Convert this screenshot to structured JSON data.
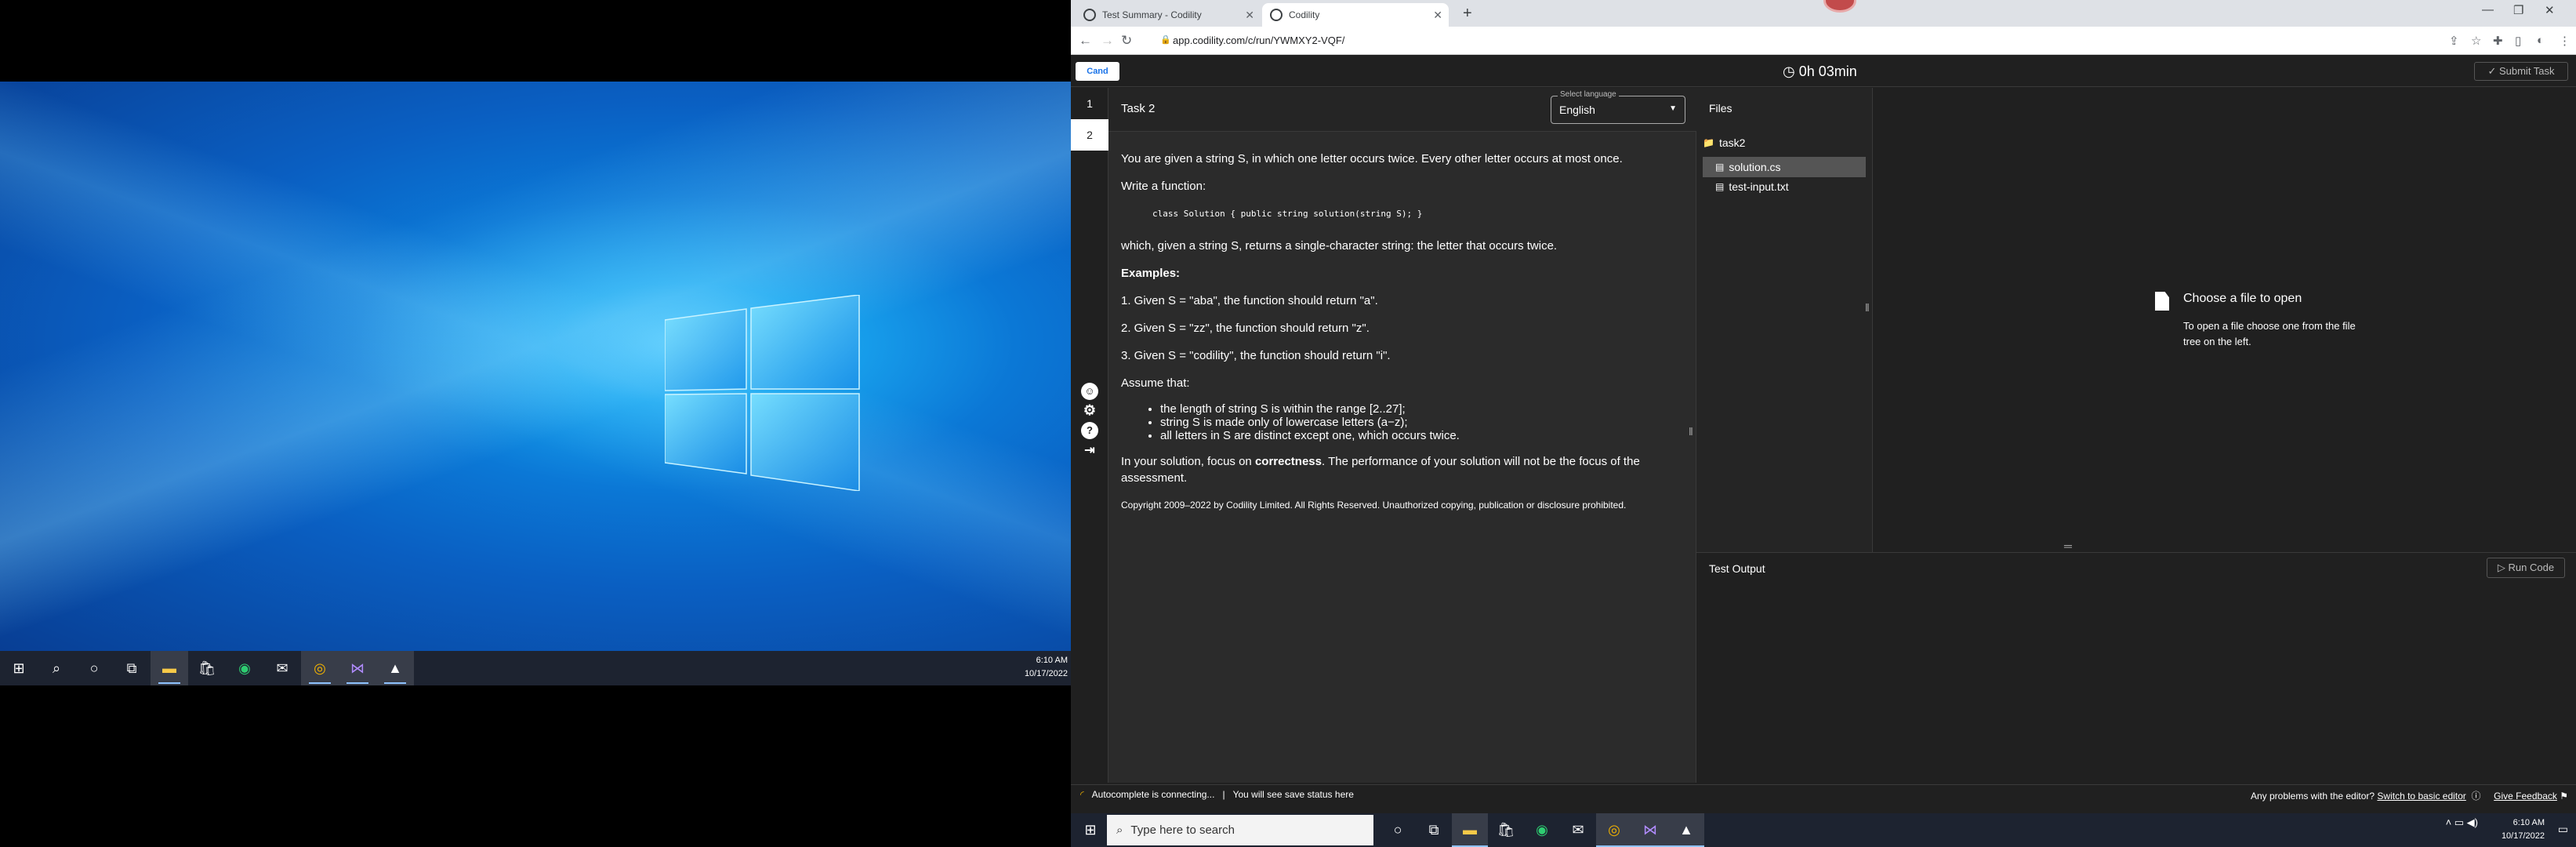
{
  "left_clock": {
    "time": "6:10 AM",
    "date": "10/17/2022"
  },
  "left_taskbar_icons": [
    "windows-start-icon",
    "search-icon",
    "cortana-icon",
    "task-view-icon",
    "file-explorer-icon",
    "store-icon",
    "edge-icon",
    "mail-icon",
    "chrome-icon",
    "visual-studio-icon",
    "photos-icon"
  ],
  "browser": {
    "tabs": [
      {
        "label": "Test Summary - Codility"
      },
      {
        "label": "Codility"
      }
    ],
    "url": "app.codility.com/c/run/YWMXY2-VQF/"
  },
  "app": {
    "logo": "Cand",
    "timer": "0h 03min",
    "submit_label": "Submit Task",
    "task_numbers": [
      "1",
      "2"
    ]
  },
  "task": {
    "title": "Task 2",
    "language_label": "Select language",
    "language_value": "English",
    "p1": "You are given a string S, in which one letter occurs twice. Every other letter occurs at most once.",
    "p2": "Write a function:",
    "code": "class Solution { public string solution(string S); }",
    "p3": "which, given a string S, returns a single-character string: the letter that occurs twice.",
    "examples_heading": "Examples:",
    "ex1": "1. Given S = \"aba\", the function should return \"a\".",
    "ex2": "2. Given S = \"zz\", the function should return \"z\".",
    "ex3": "3. Given S = \"codility\", the function should return \"i\".",
    "assume": "Assume that:",
    "bullets": [
      "the length of string S is within the range [2..27];",
      "string S is made only of lowercase letters (a−z);",
      "all letters in S are distinct except one, which occurs twice."
    ],
    "focus_pre": "In your solution, focus on ",
    "focus_bold": "correctness",
    "focus_post": ". The performance of your solution will not be the focus of the assessment.",
    "copyright": "Copyright 2009–2022 by Codility Limited. All Rights Reserved. Unauthorized copying, publication or disclosure prohibited."
  },
  "files": {
    "title": "Files",
    "folder": "task2",
    "items": [
      "solution.cs",
      "test-input.txt"
    ]
  },
  "editor": {
    "open_title": "Choose a file to open",
    "open_desc": "To open a file choose one from the file tree on the left."
  },
  "test_output": {
    "title": "Test Output",
    "run_label": "Run Code"
  },
  "status": {
    "autocomplete": "Autocomplete is connecting...",
    "separator": "|",
    "save_status": "You will see save status here",
    "problems": "Any problems with the editor?",
    "switch_link": "Switch to basic editor",
    "feedback": "Give Feedback"
  },
  "right_taskbar": {
    "search_placeholder": "Type here to search",
    "time": "6:10 AM",
    "date": "10/17/2022"
  }
}
